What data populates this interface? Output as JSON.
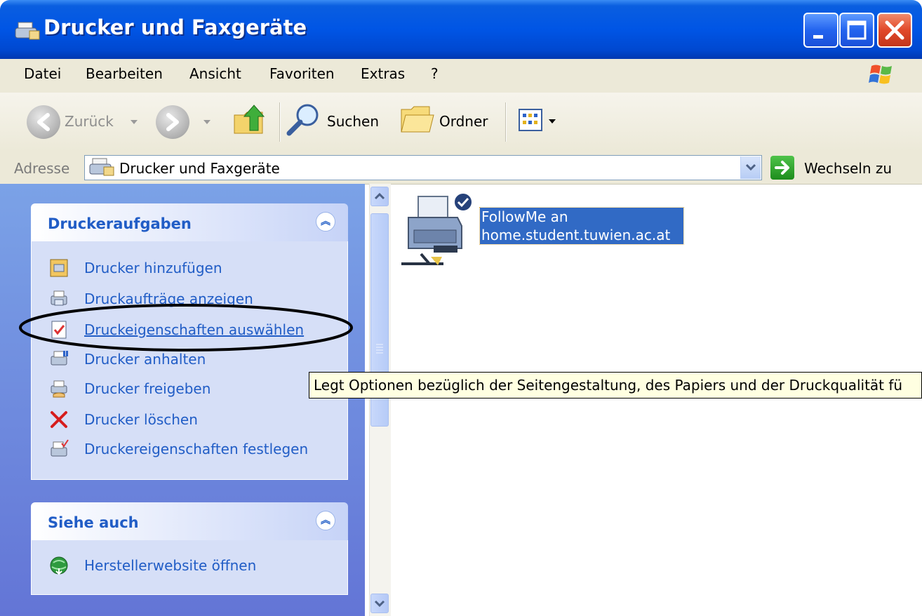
{
  "window": {
    "title": "Drucker und Faxgeräte"
  },
  "menu": [
    "Datei",
    "Bearbeiten",
    "Ansicht",
    "Favoriten",
    "Extras",
    "?"
  ],
  "toolbar": {
    "back": "Zurück",
    "search": "Suchen",
    "folders": "Ordner"
  },
  "address": {
    "label": "Adresse",
    "value": "Drucker und Faxgeräte",
    "go": "Wechseln zu"
  },
  "printer_tasks": {
    "title": "Druckeraufgaben",
    "items": [
      "Drucker hinzufügen",
      "Druckaufträge anzeigen",
      "Druckeigenschaften auswählen",
      "Drucker anhalten",
      "Drucker freigeben",
      "Drucker löschen",
      "Druckereigenschaften festlegen"
    ]
  },
  "see_also": {
    "title": "Siehe auch",
    "items": [
      "Herstellerwebsite öffnen"
    ]
  },
  "printer": {
    "line1": "FollowMe an",
    "line2": "home.student.tuwien.ac.at"
  },
  "tooltip": "Legt Optionen bezüglich der Seitengestaltung, des Papiers und der Druckqualität fü",
  "colors": {
    "titlebar": "#0055e5",
    "task_link": "#215dc6",
    "selection": "#316ac5",
    "tooltip_bg": "#ffffe1"
  }
}
